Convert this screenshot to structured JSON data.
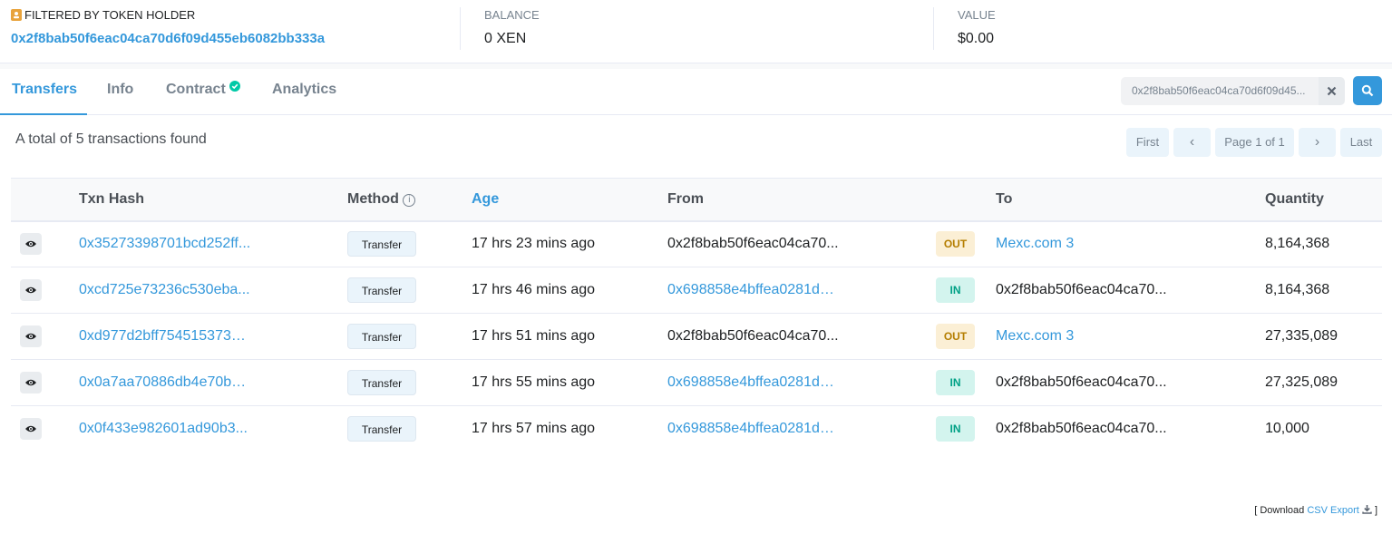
{
  "header": {
    "filter_label": "FILTERED BY TOKEN HOLDER",
    "holder_address": "0x2f8bab50f6eac04ca70d6f09d455eb6082bb333a",
    "balance_label": "BALANCE",
    "balance_value": "0 XEN",
    "value_label": "VALUE",
    "value_value": "$0.00"
  },
  "tabs": [
    {
      "label": "Transfers",
      "active": true
    },
    {
      "label": "Info",
      "active": false
    },
    {
      "label": "Contract",
      "active": false,
      "verified": true
    },
    {
      "label": "Analytics",
      "active": false
    }
  ],
  "search": {
    "value": "0x2f8bab50f6eac04ca70d6f09d45..."
  },
  "summary": "A total of 5 transactions found",
  "pagination": {
    "first": "First",
    "prev": "‹",
    "page": "Page 1 of 1",
    "next": "›",
    "last": "Last"
  },
  "table": {
    "columns": [
      "",
      "Txn Hash",
      "Method",
      "Age",
      "From",
      "",
      "To",
      "Quantity"
    ],
    "rows": [
      {
        "hash": "0x35273398701bcd252ff...",
        "method": "Transfer",
        "age": "17 hrs 23 mins ago",
        "from": "0x2f8bab50f6eac04ca70...",
        "from_link": false,
        "dir": "OUT",
        "to": "Mexc.com 3",
        "to_link": true,
        "qty": "8,164,368"
      },
      {
        "hash": "0xcd725e73236c530eba...",
        "method": "Transfer",
        "age": "17 hrs 46 mins ago",
        "from": "0x698858e4bffea0281d5...",
        "from_link": true,
        "dir": "IN",
        "to": "0x2f8bab50f6eac04ca70...",
        "to_link": false,
        "qty": "8,164,368"
      },
      {
        "hash": "0xd977d2bff7545153730...",
        "method": "Transfer",
        "age": "17 hrs 51 mins ago",
        "from": "0x2f8bab50f6eac04ca70...",
        "from_link": false,
        "dir": "OUT",
        "to": "Mexc.com 3",
        "to_link": true,
        "qty": "27,335,089"
      },
      {
        "hash": "0x0a7aa70886db4e70be...",
        "method": "Transfer",
        "age": "17 hrs 55 mins ago",
        "from": "0x698858e4bffea0281d5...",
        "from_link": true,
        "dir": "IN",
        "to": "0x2f8bab50f6eac04ca70...",
        "to_link": false,
        "qty": "27,325,089"
      },
      {
        "hash": "0x0f433e982601ad90b3...",
        "method": "Transfer",
        "age": "17 hrs 57 mins ago",
        "from": "0x698858e4bffea0281d5...",
        "from_link": true,
        "dir": "IN",
        "to": "0x2f8bab50f6eac04ca70...",
        "to_link": false,
        "qty": "10,000"
      }
    ]
  },
  "footer": {
    "open_bracket": "[ Download",
    "csv_label": "CSV Export",
    "close_bracket": "]"
  },
  "colors": {
    "accent": "#3498db",
    "out_badge": "#fbefd5",
    "in_badge": "#d3f4ee",
    "verified": "#00c9a7",
    "holder_icon": "#e8a33c"
  }
}
